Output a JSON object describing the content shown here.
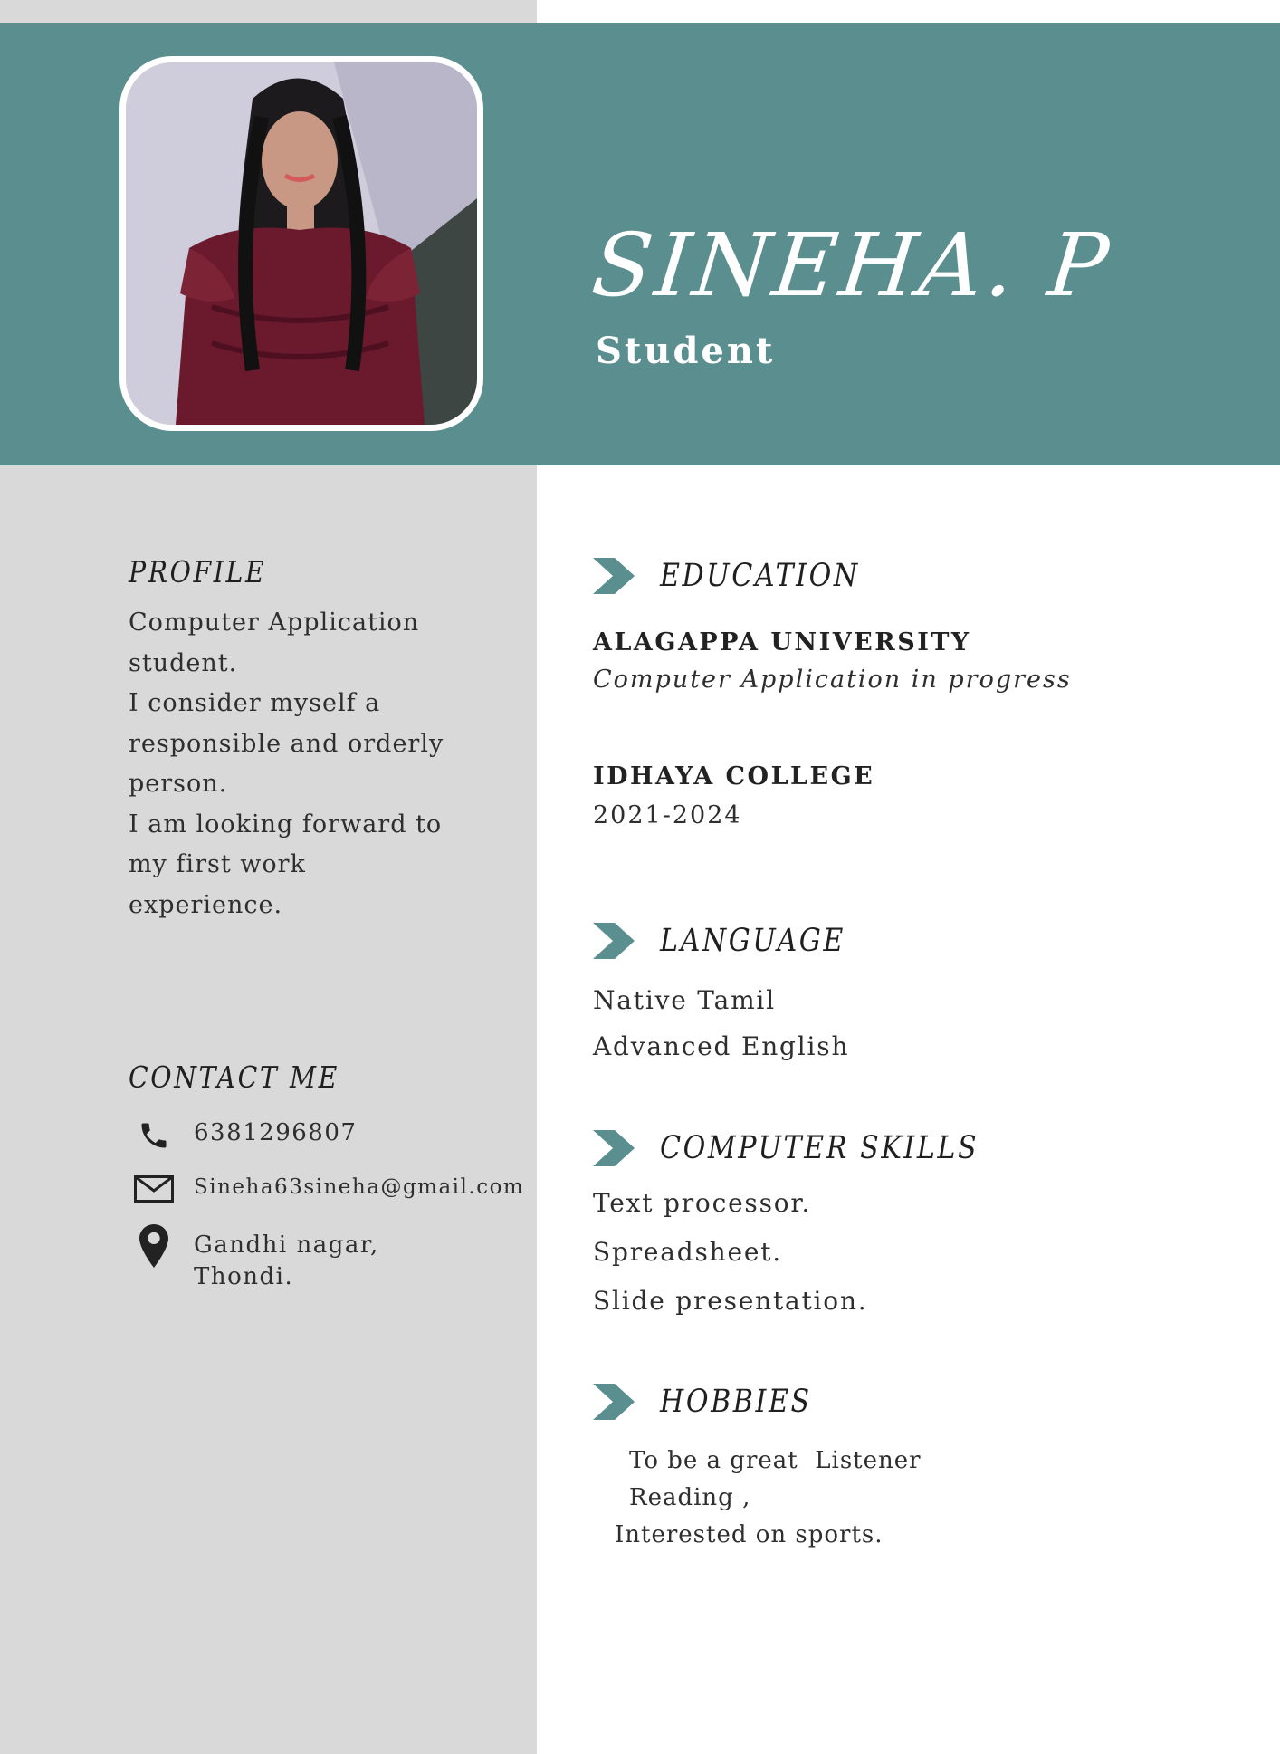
{
  "header": {
    "name": "SINEHA. P",
    "title": "Student",
    "accent_color": "#5b8f8f"
  },
  "profile": {
    "heading": "PROFILE",
    "text": "Computer Application\nstudent.\nI consider myself a\nresponsible and orderly\nperson.\nI am looking forward to\nmy first work\nexperience."
  },
  "contact": {
    "heading": "CONTACT ME",
    "phone": {
      "icon": "phone-icon",
      "value": "6381296807"
    },
    "email": {
      "icon": "envelope-icon",
      "value": "Sineha63sineha@gmail.com"
    },
    "address": {
      "icon": "location-pin-icon",
      "value": "Gandhi nagar,\nThondi."
    }
  },
  "education": {
    "heading": "EDUCATION",
    "entries": [
      {
        "institution": "ALAGAPPA UNIVERSITY",
        "detail": "Computer Application in progress"
      },
      {
        "institution": "IDHAYA COLLEGE",
        "detail": "2021-2024"
      }
    ]
  },
  "language": {
    "heading": "LANGUAGE",
    "items": [
      "Native Tamil",
      "Advanced English"
    ]
  },
  "computer_skills": {
    "heading": "COMPUTER SKILLS",
    "items": [
      "Text processor.",
      "Spreadsheet.",
      "Slide presentation."
    ]
  },
  "hobbies": {
    "heading": "HOBBIES",
    "items": [
      "To be a great  Listener",
      "Reading ,",
      "Interested on sports."
    ]
  }
}
